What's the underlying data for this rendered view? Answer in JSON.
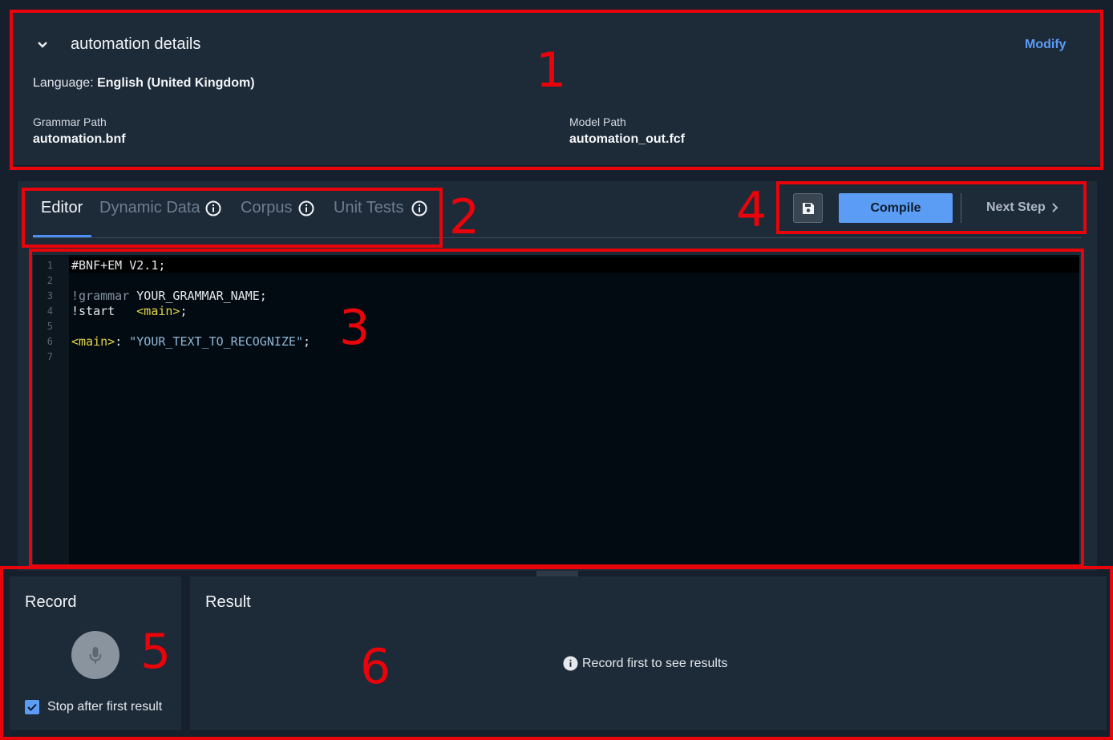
{
  "details": {
    "title": "automation details",
    "modify_label": "Modify",
    "language_label": "Language:",
    "language_value": "English (United Kingdom)",
    "grammar_path_label": "Grammar Path",
    "grammar_path_value": "automation.bnf",
    "model_path_label": "Model Path",
    "model_path_value": "automation_out.fcf"
  },
  "tabs": [
    {
      "label": "Editor",
      "active": true
    },
    {
      "label": "Dynamic Data",
      "active": false,
      "icon": "info-icon"
    },
    {
      "label": "Corpus",
      "active": false,
      "icon": "info-icon"
    },
    {
      "label": "Unit Tests",
      "active": false,
      "icon": "info-icon"
    }
  ],
  "toolbar": {
    "save_icon": "floppy-disk-icon",
    "compile_label": "Compile",
    "next_step_label": "Next Step"
  },
  "editor": {
    "line_numbers": [
      "1",
      "2",
      "3",
      "4",
      "5",
      "6",
      "7"
    ],
    "line1": "#BNF+EM V2.1;",
    "line3_kw": "!grammar",
    "line3_rest": " YOUR_GRAMMAR_NAME;",
    "line4_kw": "!start",
    "line4_sp": "   ",
    "line4_rule": "<main>",
    "line4_end": ";",
    "line6_rule": "<main>",
    "line6_colon": ": ",
    "line6_str": "\"YOUR_TEXT_TO_RECOGNIZE\"",
    "line6_end": ";"
  },
  "record": {
    "title": "Record",
    "checkbox_label": "Stop after first result",
    "checkbox_checked": true
  },
  "result": {
    "title": "Result",
    "message": "Record first to see results"
  },
  "annotations": [
    "1",
    "2",
    "3",
    "4",
    "5",
    "6"
  ],
  "colors": {
    "accent": "#5b9cf5",
    "annotation": "#e8040a",
    "panel": "#1d2a38",
    "background": "#16202c"
  }
}
